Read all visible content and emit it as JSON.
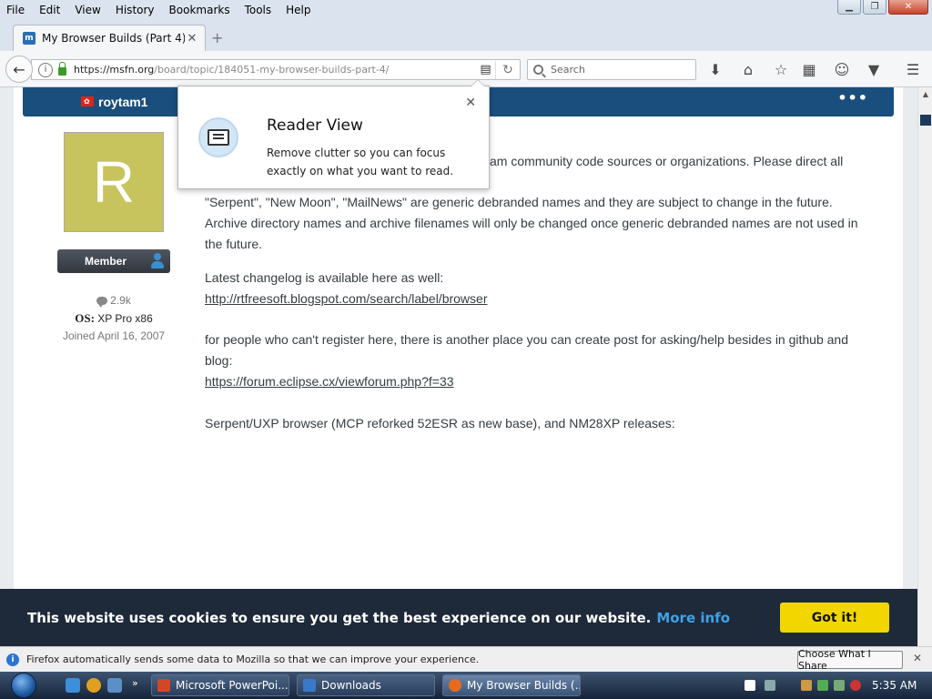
{
  "menubar": {
    "items": [
      "File",
      "Edit",
      "View",
      "History",
      "Bookmarks",
      "Tools",
      "Help"
    ]
  },
  "tab": {
    "title": "My Browser Builds (Part 4) - B..."
  },
  "navbar": {
    "url_host": "https://msfn.org",
    "url_path": "/board/topic/184051-my-browser-builds-part-4/",
    "search_placeholder": "Search"
  },
  "post": {
    "author": "roytam1",
    "avatar_letter": "R",
    "badge": "Member",
    "posts_count": "2.9k",
    "os_label": "OS:",
    "os_value": "XP Pro x86",
    "joined": "Joined April 16, 2007",
    "para1_tail": "am community code sources or organizations. Please direct all",
    "para2": "\"Serpent\", \"New Moon\", \"MailNews\" are generic debranded names and they are subject to change in the future. Archive directory names and archive filenames will only be changed once generic debranded names are not used in the future.",
    "para3": "Latest changelog is available here as well:",
    "link1": "http://rtfreesoft.blogspot.com/search/label/browser",
    "para4": "for people who can't register here, there is another place you can create post for asking/help besides in github and blog:",
    "link2": "https://forum.eclipse.cx/viewforum.php?f=33",
    "para5": "Serpent/UXP browser (MCP reforked 52ESR as new base), and NM28XP releases:"
  },
  "reader_popup": {
    "title": "Reader View",
    "description": "Remove clutter so you can focus exactly on what you want to read."
  },
  "cookie_bar": {
    "text": "This website uses cookies to ensure you get the best experience on our website.",
    "more_info": "More info",
    "button": "Got it!"
  },
  "notification": {
    "text": "Firefox automatically sends some data to Mozilla so that we can improve your experience.",
    "button": "Choose What I Share"
  },
  "taskbar": {
    "items": [
      "Microsoft PowerPoi...",
      "Downloads",
      "My Browser Builds (..."
    ],
    "time": "5:35 AM"
  },
  "colors": {
    "post_header": "#1a4e7c",
    "avatar_bg": "#c7c45e",
    "cookie_bar_bg": "#1e2a3a",
    "cookie_button": "#f1d600",
    "cookie_link": "#3ea2e6"
  }
}
